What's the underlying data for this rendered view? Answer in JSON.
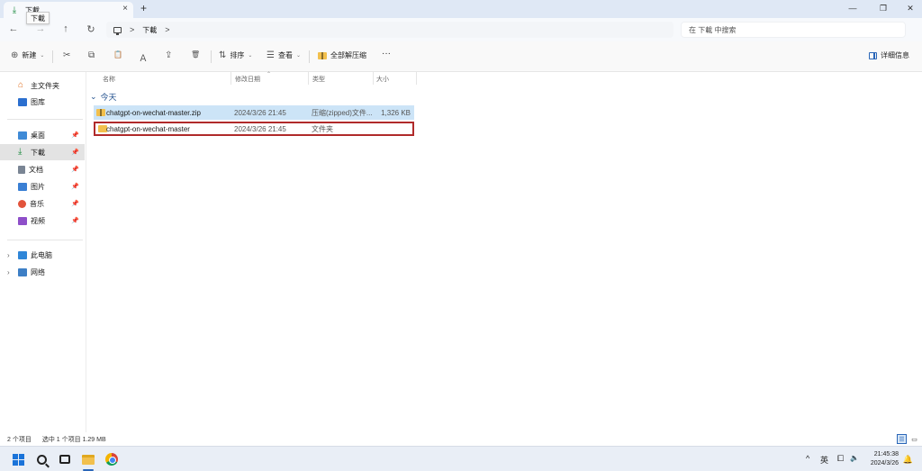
{
  "window": {
    "tab_title": "下載",
    "tab_tooltip": "下載",
    "tab_close": "×",
    "new_tab": "+",
    "minimize": "—",
    "maximize": "❐",
    "close": "✕"
  },
  "address": {
    "nav_back": "←",
    "nav_forward": "→",
    "nav_up": "↑",
    "refresh": "↻",
    "separator": ">",
    "crumb": "下載",
    "search_placeholder": "在 下載 中搜索"
  },
  "commands": {
    "new": {
      "icon": "⊕",
      "label": "新建",
      "caret": "⌄"
    },
    "cut_icon": "✂",
    "copy_icon": "⧉",
    "paste_icon": "📋",
    "rename_icon": "Ａ",
    "share_icon": "⇪",
    "delete_icon": "🗑",
    "sort": {
      "icon": "⇅",
      "label": "排序",
      "caret": "⌄"
    },
    "view": {
      "icon": "☰",
      "label": "查看",
      "caret": "⌄"
    },
    "extract": {
      "label": "全部解压缩"
    },
    "more": "···",
    "details": "详细信息"
  },
  "sidebar": {
    "items": [
      {
        "label": "主文件夹",
        "icon": "home-icon"
      },
      {
        "label": "图库",
        "icon": "gallery-icon"
      },
      {
        "label": "桌面",
        "icon": "desktop-icon",
        "pinned": true
      },
      {
        "label": "下載",
        "icon": "download-icon",
        "pinned": true,
        "active": true
      },
      {
        "label": "文档",
        "icon": "documents-icon",
        "pinned": true
      },
      {
        "label": "图片",
        "icon": "pictures-icon",
        "pinned": true
      },
      {
        "label": "音乐",
        "icon": "music-icon",
        "pinned": true
      },
      {
        "label": "视频",
        "icon": "videos-icon",
        "pinned": true
      },
      {
        "label": "此电脑",
        "icon": "pc-icon",
        "expandable": true
      },
      {
        "label": "网络",
        "icon": "network-icon",
        "expandable": true
      }
    ],
    "pin_glyph": "📌",
    "expander_glyph": "›"
  },
  "columns": {
    "name": "名称",
    "date": "修改日期",
    "type": "类型",
    "size": "大小",
    "sort_caret": "⌃"
  },
  "group": {
    "caret": "⌄",
    "label": "今天"
  },
  "files": [
    {
      "name": "chatgpt-on-wechat-master.zip",
      "date": "2024/3/26 21:45",
      "type": "压缩(zipped)文件...",
      "size": "1,326 KB",
      "selected": true
    },
    {
      "name": "chatgpt-on-wechat-master",
      "date": "2024/3/26 21:45",
      "type": "文件夹",
      "size": "",
      "highlighted": true
    }
  ],
  "status": {
    "count": "2 个项目",
    "selection": "选中 1 个项目  1.29 MB",
    "details_view": "☰",
    "tiles_view": "▭"
  },
  "taskbar": {
    "tray_chevron": "^",
    "ime": "英",
    "display_icon": "⧠",
    "volume_icon": "🔈",
    "time": "21:45:38",
    "date": "2024/3/26",
    "bell": "🔔"
  },
  "colors": {
    "accent": "#2a66b8",
    "selection": "#cce4f7",
    "highlight_border": "#b02a2a",
    "folder": "#f2c04d"
  }
}
